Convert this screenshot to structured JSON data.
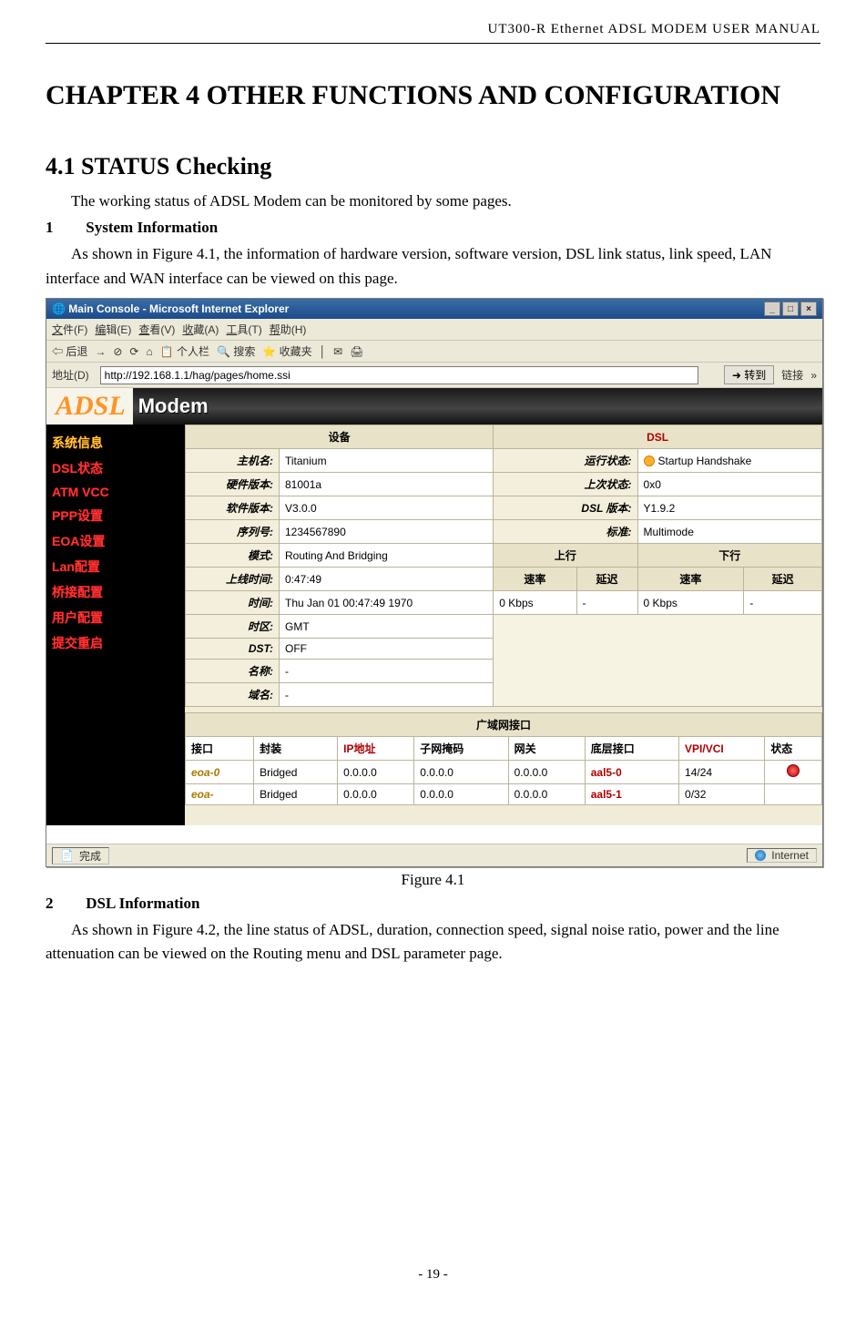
{
  "header": "UT300-R  Ethernet  ADSL  MODEM  USER  MANUAL",
  "chapter_title": "CHAPTER 4 OTHER FUNCTIONS AND CONFIGURATION",
  "section_title": "4.1 STATUS Checking",
  "intro": "The working status of ADSL Modem can be monitored by some pages.",
  "item1_num": "1",
  "item1_title": "System Information",
  "item1_body": "As shown in Figure 4.1, the information of hardware version, software version, DSL link status, link speed, LAN interface and WAN interface can be viewed on this page.",
  "caption1": "Figure 4.1",
  "item2_num": "2",
  "item2_title": "DSL Information",
  "item2_body": "As shown in Figure 4.2, the line status of ADSL, duration, connection speed, signal noise ratio, power and the line attenuation can be viewed on the Routing menu and DSL parameter page.",
  "page_number": "- 19 -",
  "ie": {
    "title": "Main Console - Microsoft Internet Explorer",
    "menus": [
      "文件(F)",
      "编辑(E)",
      "查看(V)",
      "收藏(A)",
      "工具(T)",
      "帮助(H)"
    ],
    "tb_back": "后退",
    "tb_personal": "个人栏",
    "tb_search": "搜索",
    "tb_fav": "收藏夹",
    "addr_label": "地址(D)",
    "addr_value": "http://192.168.1.1/hag/pages/home.ssi",
    "go": "转到",
    "links": "链接",
    "status_left": "完成",
    "status_right": "Internet"
  },
  "banner": {
    "adsl": "ADSL",
    "modem": "Modem"
  },
  "sidebar": {
    "items": [
      {
        "label": "系统信息",
        "cls": "yellow"
      },
      {
        "label": "DSL状态",
        "cls": ""
      },
      {
        "label": "ATM  VCC",
        "cls": ""
      },
      {
        "label": "PPP设置",
        "cls": ""
      },
      {
        "label": "EOA设置",
        "cls": ""
      },
      {
        "label": "Lan配置",
        "cls": ""
      },
      {
        "label": "桥接配置",
        "cls": ""
      },
      {
        "label": "用户配置",
        "cls": ""
      },
      {
        "label": "提交重启",
        "cls": ""
      }
    ]
  },
  "dev": {
    "head_device": "设备",
    "head_dsl": "DSL",
    "rows": [
      {
        "l1": "主机名:",
        "v1": "Titanium",
        "l2": "运行状态:",
        "v2": "Startup Handshake",
        "icon": true
      },
      {
        "l1": "硬件版本:",
        "v1": "81001a",
        "l2": "上次状态:",
        "v2": "0x0"
      },
      {
        "l1": "软件版本:",
        "v1": "V3.0.0",
        "l2": "DSL 版本:",
        "v2": "Y1.9.2"
      },
      {
        "l1": "序列号:",
        "v1": "1234567890",
        "l2": "标准:",
        "v2": "Multimode"
      }
    ],
    "mode_l": "模式:",
    "mode_v": "Routing And Bridging",
    "up": "上行",
    "down": "下行",
    "uptime_l": "上线时间:",
    "uptime_v": "0:47:49",
    "rate": "速率",
    "delay": "延迟",
    "time_l": "时间:",
    "time_v": "Thu Jan 01 00:47:49 1970",
    "rate_up": "0 Kbps",
    "delay_up": "-",
    "rate_dn": "0 Kbps",
    "delay_dn": "-",
    "tz_l": "时区:",
    "tz_v": "GMT",
    "dst_l": "DST:",
    "dst_v": "OFF",
    "name_l": "名称:",
    "name_v": "-",
    "domain_l": "域名:",
    "domain_v": "-"
  },
  "wan": {
    "title": "广域网接口",
    "cols": [
      "接口",
      "封装",
      "IP地址",
      "子网掩码",
      "网关",
      "底层接口",
      "VPI/VCI",
      "状态"
    ],
    "rows": [
      {
        "if": "eoa-0",
        "enc": "Bridged",
        "ip": "0.0.0.0",
        "mask": "0.0.0.0",
        "gw": "0.0.0.0",
        "base": "aal5-0",
        "vpi": "14/24"
      },
      {
        "if": "eoa-",
        "enc": "Bridged",
        "ip": "0.0.0.0",
        "mask": "0.0.0.0",
        "gw": "0.0.0.0",
        "base": "aal5-1",
        "vpi": "0/32"
      }
    ]
  }
}
